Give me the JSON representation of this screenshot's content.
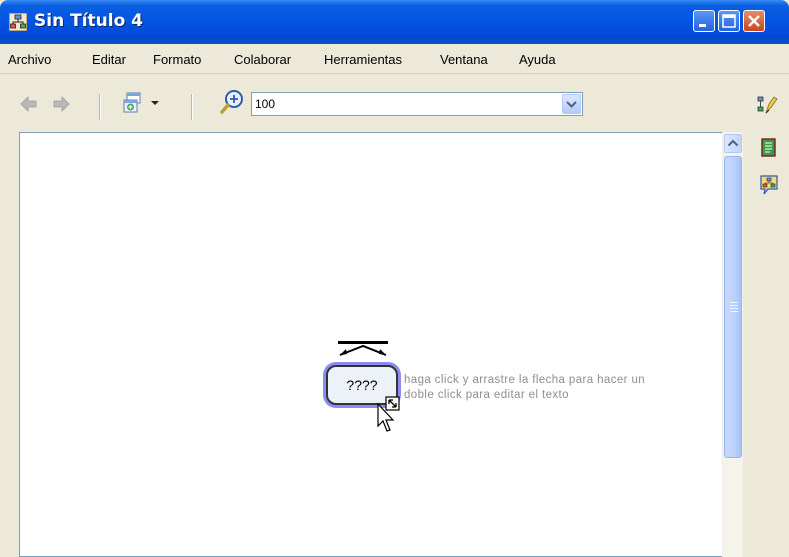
{
  "window": {
    "title": "Sin Título 4",
    "title_bar_color": "#0454E3",
    "controls": [
      "minimize-icon",
      "maximize-icon",
      "close-icon"
    ]
  },
  "menu": {
    "items": [
      "Archivo",
      "Editar",
      "Formato",
      "Colaborar",
      "Herramientas",
      "Ventana",
      "Ayuda"
    ]
  },
  "toolbar": {
    "zoom_value": "100",
    "icons": [
      "back-arrow-icon",
      "forward-arrow-icon",
      "add-item-icon",
      "zoom-icon",
      "chevron-down-icon",
      "style-toolbar-icon"
    ]
  },
  "side_panel": {
    "icons": [
      "notes-icon",
      "chat-map-icon"
    ]
  },
  "canvas": {
    "node_text": "????",
    "hint_line_1": "haga click y arrastre la flecha para hacer un",
    "hint_line_2": "doble click para editar el texto",
    "node_border_color": "#8C8BF3"
  }
}
